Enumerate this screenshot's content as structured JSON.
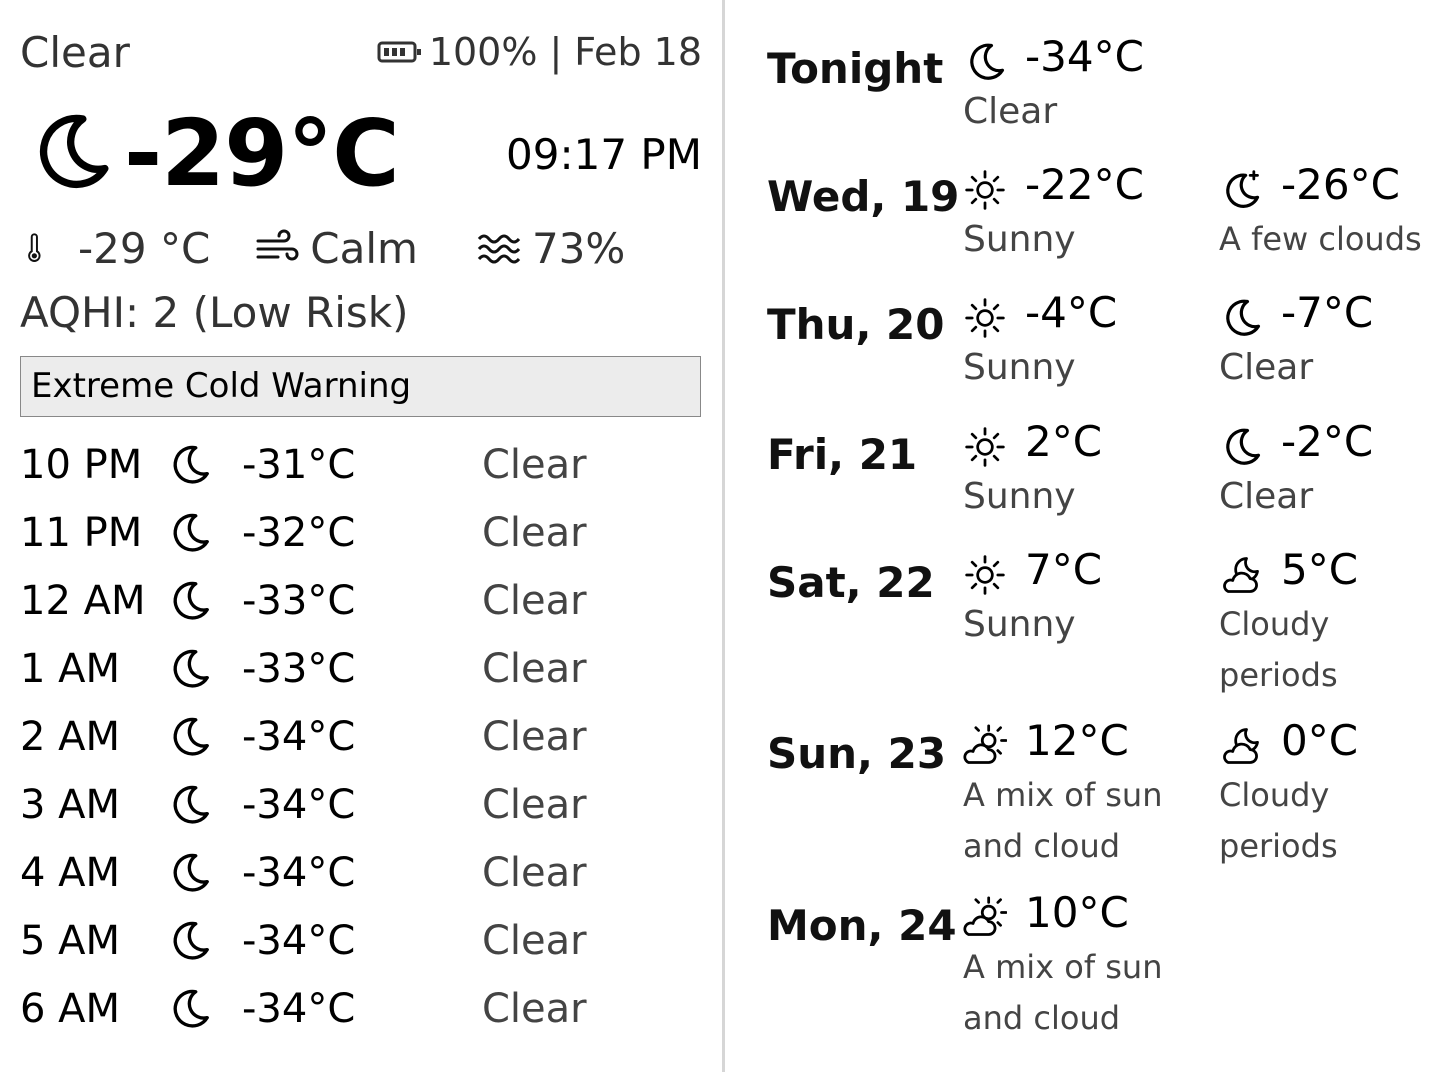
{
  "current": {
    "condition": "Clear",
    "battery": "100%",
    "separator": "|",
    "date": "Feb 18",
    "icon": "moon-icon",
    "temperature": "-29°C",
    "time": "09:17 PM",
    "feels_like": "-29 °C",
    "wind": "Calm",
    "humidity": "73%",
    "aqhi": "AQHI: 2 (Low Risk)"
  },
  "alert": {
    "text": "Extreme Cold Warning"
  },
  "hourly": [
    {
      "hour": "10 PM",
      "icon": "moon-icon",
      "temp": "-31°C",
      "condition": "Clear"
    },
    {
      "hour": "11 PM",
      "icon": "moon-icon",
      "temp": "-32°C",
      "condition": "Clear"
    },
    {
      "hour": "12 AM",
      "icon": "moon-icon",
      "temp": "-33°C",
      "condition": "Clear"
    },
    {
      "hour": "1 AM",
      "icon": "moon-icon",
      "temp": "-33°C",
      "condition": "Clear"
    },
    {
      "hour": "2 AM",
      "icon": "moon-icon",
      "temp": "-34°C",
      "condition": "Clear"
    },
    {
      "hour": "3 AM",
      "icon": "moon-icon",
      "temp": "-34°C",
      "condition": "Clear"
    },
    {
      "hour": "4 AM",
      "icon": "moon-icon",
      "temp": "-34°C",
      "condition": "Clear"
    },
    {
      "hour": "5 AM",
      "icon": "moon-icon",
      "temp": "-34°C",
      "condition": "Clear"
    },
    {
      "hour": "6 AM",
      "icon": "moon-icon",
      "temp": "-34°C",
      "condition": "Clear"
    }
  ],
  "forecast": [
    {
      "day": "Tonight",
      "night": {
        "icon": "moon-icon",
        "temp": "-34°C",
        "condition": "Clear"
      }
    },
    {
      "day": "Wed, 19",
      "day_period": {
        "icon": "sun-icon",
        "temp": "-22°C",
        "condition": "Sunny"
      },
      "night": {
        "icon": "moon-few-clouds-icon",
        "temp": "-26°C",
        "condition": "A few clouds"
      }
    },
    {
      "day": "Thu, 20",
      "day_period": {
        "icon": "sun-icon",
        "temp": "-4°C",
        "condition": "Sunny"
      },
      "night": {
        "icon": "moon-icon",
        "temp": "-7°C",
        "condition": "Clear"
      }
    },
    {
      "day": "Fri, 21",
      "day_period": {
        "icon": "sun-icon",
        "temp": "2°C",
        "condition": "Sunny"
      },
      "night": {
        "icon": "moon-icon",
        "temp": "-2°C",
        "condition": "Clear"
      }
    },
    {
      "day": "Sat, 22",
      "day_period": {
        "icon": "sun-icon",
        "temp": "7°C",
        "condition": "Sunny"
      },
      "night": {
        "icon": "moon-cloud-icon",
        "temp": "5°C",
        "condition": "Cloudy periods"
      }
    },
    {
      "day": "Sun, 23",
      "day_period": {
        "icon": "sun-cloud-icon",
        "temp": "12°C",
        "condition": "A mix of sun and cloud"
      },
      "night": {
        "icon": "moon-cloud-icon",
        "temp": "0°C",
        "condition": "Cloudy periods"
      }
    },
    {
      "day": "Mon, 24",
      "day_period": {
        "icon": "sun-cloud-icon",
        "temp": "10°C",
        "condition": "A mix of sun and cloud"
      }
    }
  ]
}
